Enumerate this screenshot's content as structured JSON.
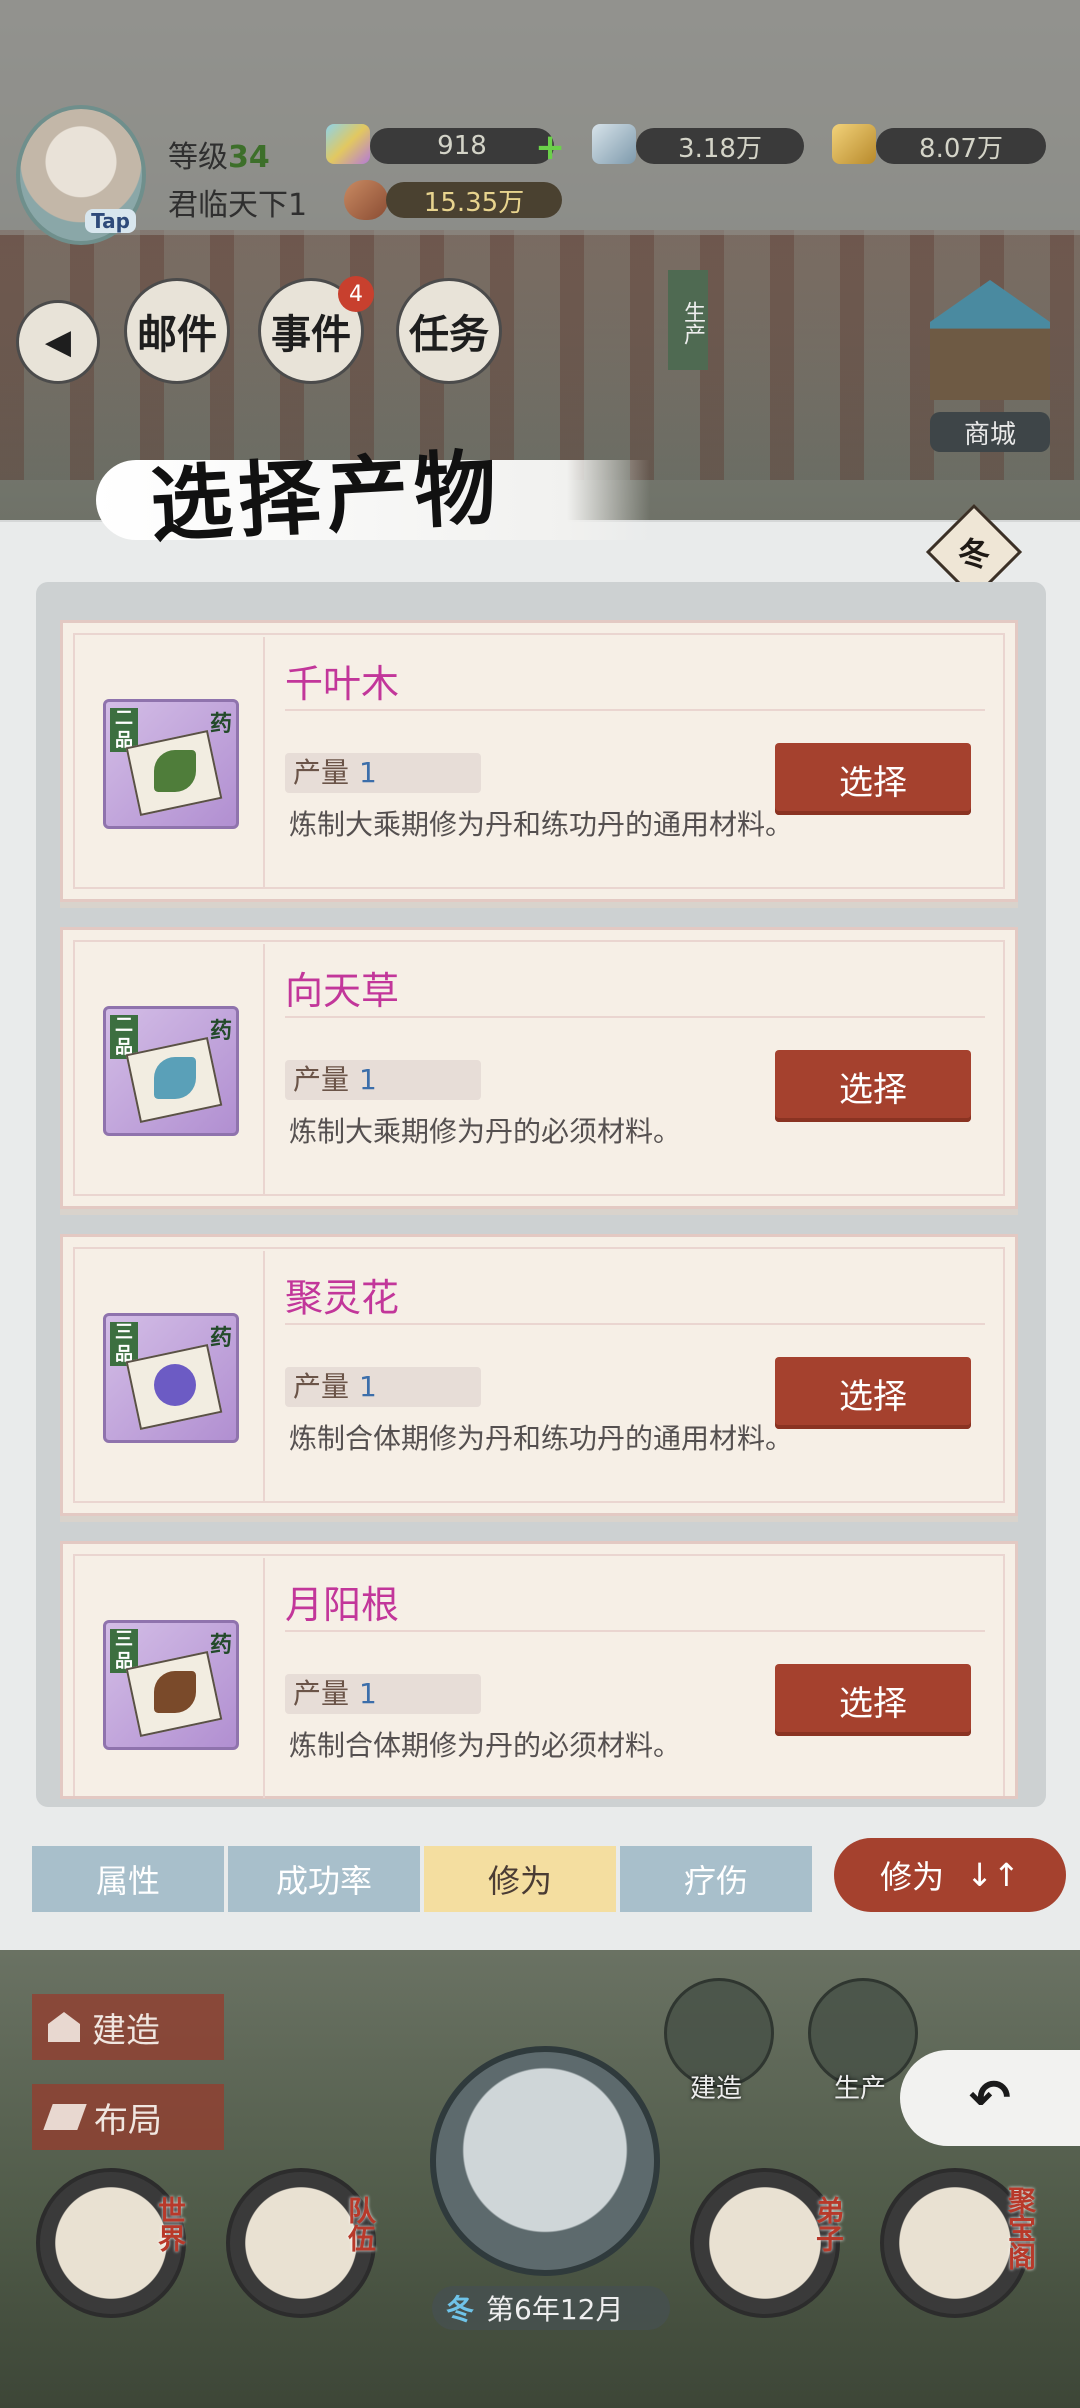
{
  "header": {
    "level_label": "等级",
    "level_value": "34",
    "player_name": "君临天下1",
    "avatar_badge": "Tap",
    "resources": [
      {
        "icon": "spirit-stone-icon",
        "value": "918"
      },
      {
        "icon": "ore-icon",
        "value": "3.18万"
      },
      {
        "icon": "gold-icon",
        "value": "8.07万"
      },
      {
        "icon": "meat-icon",
        "value": "15.35万"
      }
    ],
    "plus_symbol": "+"
  },
  "nav": {
    "back_symbol": "◀",
    "mail": "邮件",
    "events": "事件",
    "events_badge": "4",
    "tasks": "任务",
    "produce_tag": "生产",
    "mall": "商城"
  },
  "panel": {
    "title": "选择产物",
    "season_badge": "冬"
  },
  "items": [
    {
      "name": "千叶木",
      "grade": "二品",
      "kind": "药",
      "yield_label": "产量",
      "yield_value": "1",
      "desc": "炼制大乘期修为丹和练功丹的通用材料。",
      "select_label": "选择",
      "herb_color": "#4f7d3a"
    },
    {
      "name": "向天草",
      "grade": "二品",
      "kind": "药",
      "yield_label": "产量",
      "yield_value": "1",
      "desc": "炼制大乘期修为丹的必须材料。",
      "select_label": "选择",
      "herb_color": "#5aa0b8"
    },
    {
      "name": "聚灵花",
      "grade": "三品",
      "kind": "药",
      "yield_label": "产量",
      "yield_value": "1",
      "desc": "炼制合体期修为丹和练功丹的通用材料。",
      "select_label": "选择",
      "herb_color": "#6c5bc4"
    },
    {
      "name": "月阳根",
      "grade": "三品",
      "kind": "药",
      "yield_label": "产量",
      "yield_value": "1",
      "desc": "炼制合体期修为丹的必须材料。",
      "select_label": "选择",
      "herb_color": "#7a4a2a"
    }
  ],
  "sort": {
    "tabs": [
      "属性",
      "成功率",
      "修为",
      "疗伤"
    ],
    "active_index": 2,
    "order_label": "修为",
    "order_icon": "↓↑"
  },
  "bottom": {
    "build": "建造",
    "layout": "布局",
    "build_mini": "建造",
    "produce_mini": "生产",
    "world": "世界",
    "team": "队伍",
    "disciples": "弟子",
    "treasure": "聚宝阁",
    "season": "冬",
    "date": "第6年12月",
    "back_symbol": "↶"
  },
  "colors": {
    "accent_red": "#a5412e",
    "item_name": "#c2369a",
    "active_tab": "#f4dea0",
    "inactive_tab": "#a8bfcb"
  }
}
